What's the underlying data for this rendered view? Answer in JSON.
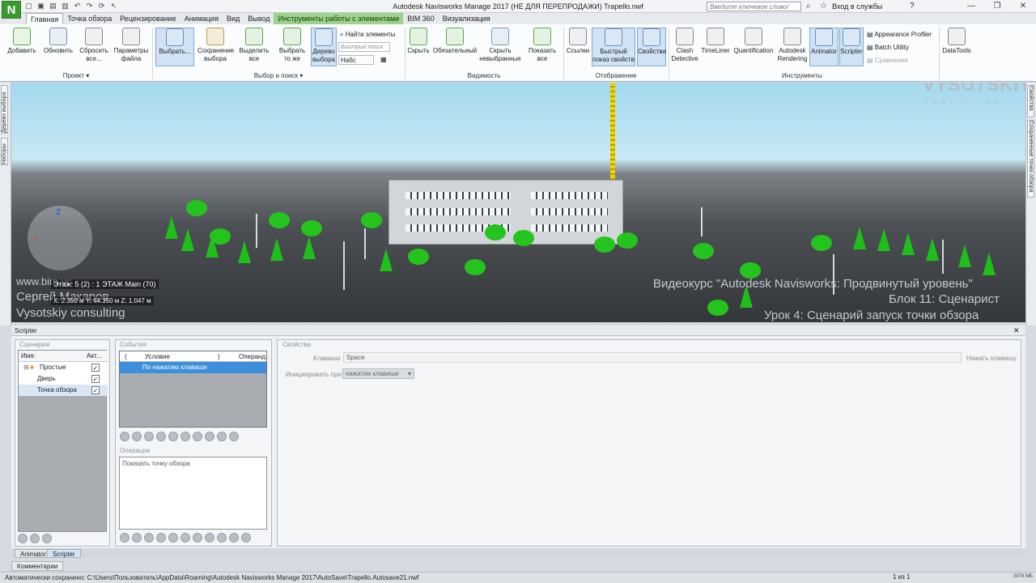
{
  "app": {
    "logo_letter": "N",
    "title": "Autodesk Navisworks Manage 2017 (НЕ ДЛЯ ПЕРЕПРОДАЖИ)   Trapello.nwf",
    "search_placeholder": "Введите ключевое слово/фразу",
    "signin_label": "Вход в службы"
  },
  "tabs": [
    {
      "label": "Главная",
      "active": true
    },
    {
      "label": "Точка обзора"
    },
    {
      "label": "Рецензирование"
    },
    {
      "label": "Анимация"
    },
    {
      "label": "Вид"
    },
    {
      "label": "Вывод"
    },
    {
      "label": "Инструменты работы с элементами",
      "contextual": true
    },
    {
      "label": "BIM 360"
    },
    {
      "label": "Визуализация"
    }
  ],
  "ribbon": {
    "project": {
      "label": "Проект ▾",
      "buttons": [
        "Добавить",
        "Обновить",
        "Сбросить все...",
        "Параметры файла"
      ]
    },
    "select": {
      "label": "Выбор и поиск ▾",
      "buttons": [
        "Выбрать...",
        "Сохранение выбора",
        "Выделить все",
        "Выбрать то же",
        "Дерево выбора"
      ],
      "find_items": "Найти элементы",
      "quick_find_placeholder": "Быстрый поиск",
      "sets_label": "Набс"
    },
    "visibility": {
      "label": "Видимость",
      "buttons": [
        "Скрыть",
        "Обязательный",
        "Скрыть невыбранные",
        "Показать все"
      ]
    },
    "display": {
      "label": "Отображение",
      "buttons": [
        "Ссылки",
        "Быстрый показ свойств",
        "Свойства"
      ]
    },
    "tools": {
      "label": "Инструменты",
      "buttons": [
        "Clash Detective",
        "TimeLiner",
        "Quantification",
        "Autodesk Rendering",
        "Animator",
        "Scripter"
      ],
      "small": [
        "Appearance Profiler",
        "Batch Utility",
        "Сравнение"
      ]
    },
    "datatools": "DataTools"
  },
  "side_tabs": {
    "left": [
      "Дерево выбора",
      "Наборы"
    ],
    "right": [
      "Свойства",
      "Сохраненные точки обзора"
    ]
  },
  "viewport": {
    "url_text": "www.bim.vc",
    "author_text": "Сергей Макаров",
    "corp_text": "Vysotskiy consulting",
    "info1": "Этаж: 5 (2) : 1 ЭТАЖ Main (70)",
    "info2": "X: 2.350 м  Y: 44.350 м  Z: 1.047 м",
    "watermark1": "Видеокурс \"Autodesk Navisworks: Продвинутый уровень\"",
    "watermark2": "Блок 11: Сценарист",
    "watermark3": "Урок 4: Сценарий запуск точки обзора",
    "logo_text": "VYSOTSKIY",
    "logo_sub": "CONSULTING",
    "axis_z": "Z",
    "axis_x": "X"
  },
  "scripter": {
    "title": "Scripter",
    "scenarios_title": "Сценарии",
    "col_name": "Имя:",
    "col_active": "Акт...",
    "rows": [
      {
        "label": "Простые",
        "checked": true
      },
      {
        "label": "Дверь",
        "checked": true
      },
      {
        "label": "Точка обзора",
        "checked": true
      }
    ],
    "events_title": "События",
    "events_cols": [
      "(",
      "Условие",
      ")",
      "Операнд"
    ],
    "event_row": "По нажатию клавиши",
    "operations_title": "Операции",
    "operation": "Показать точку обзора",
    "props_title": "Свойства",
    "key_label": "Клавиша",
    "key_value": "Space",
    "press_key_btn": "Нажать клавишу",
    "init_label": "Инициировать при",
    "init_value": "нажатии клавиши"
  },
  "bottom_tabs": [
    "Animator",
    "Scripter"
  ],
  "comments_tab": "Комментарии",
  "status": {
    "autosave": "Автоматически сохранено: C:\\Users\\Пользователь\\AppData\\Roaming\\Autodesk Navisworks Manage 2017\\AutoSave\\Trapello.Autosave21.nwf",
    "page": "1 из 1",
    "mem": "2976 МБ"
  }
}
